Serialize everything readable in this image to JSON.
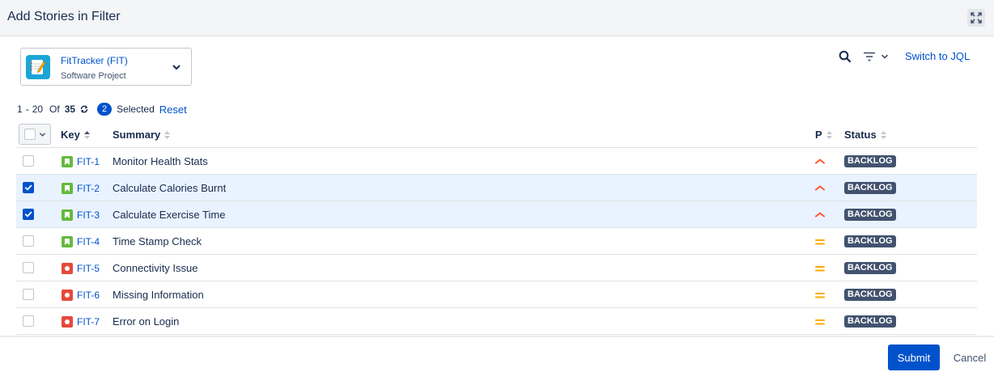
{
  "modal": {
    "title": "Add Stories in Filter"
  },
  "project": {
    "name": "FitTracker (FIT)",
    "type": "Software Project"
  },
  "toolbar": {
    "jql_label": "Switch to JQL"
  },
  "pager": {
    "from": "1",
    "dash": "-",
    "to": "20",
    "of_label": "Of",
    "total": "35"
  },
  "selection": {
    "count": "2",
    "label": "Selected",
    "reset_label": "Reset"
  },
  "columns": {
    "key": "Key",
    "summary": "Summary",
    "priority": "P",
    "status": "Status"
  },
  "rows": [
    {
      "key": "FIT-1",
      "summary": "Monitor Health Stats",
      "type": "story",
      "priority": "high",
      "status": "BACKLOG",
      "selected": false
    },
    {
      "key": "FIT-2",
      "summary": "Calculate Calories Burnt",
      "type": "story",
      "priority": "high",
      "status": "BACKLOG",
      "selected": true
    },
    {
      "key": "FIT-3",
      "summary": "Calculate Exercise Time",
      "type": "story",
      "priority": "high",
      "status": "BACKLOG",
      "selected": true
    },
    {
      "key": "FIT-4",
      "summary": "Time Stamp Check",
      "type": "story",
      "priority": "medium",
      "status": "BACKLOG",
      "selected": false
    },
    {
      "key": "FIT-5",
      "summary": "Connectivity Issue",
      "type": "bug",
      "priority": "medium",
      "status": "BACKLOG",
      "selected": false
    },
    {
      "key": "FIT-6",
      "summary": "Missing Information",
      "type": "bug",
      "priority": "medium",
      "status": "BACKLOG",
      "selected": false
    },
    {
      "key": "FIT-7",
      "summary": "Error on Login",
      "type": "bug",
      "priority": "medium",
      "status": "BACKLOG",
      "selected": false
    }
  ],
  "footer": {
    "submit_label": "Submit",
    "cancel_label": "Cancel"
  },
  "colors": {
    "accent": "#0052cc",
    "story": "#63ba3c",
    "bug": "#e5493a",
    "priority_high": "#ff5630",
    "priority_medium": "#ffab00",
    "status_bg": "#42526e",
    "selected_row": "#e9f2ff"
  },
  "icons": {
    "expand": "expand-icon",
    "search": "search-icon",
    "filter": "filter-icon",
    "refresh": "refresh-icon",
    "sort": "sort-icon",
    "story": "story-icon",
    "bug": "bug-icon"
  }
}
